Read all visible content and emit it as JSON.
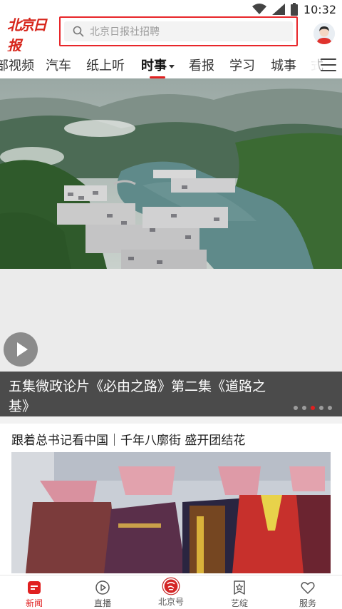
{
  "status_bar": {
    "time": "10:32",
    "icons": [
      "wifi-icon",
      "signal-icon",
      "battery-icon"
    ]
  },
  "header": {
    "logo_text": "北京日报",
    "search_placeholder": "北京日报社招聘",
    "avatar_icon": "user-avatar-icon"
  },
  "tabs": [
    {
      "label": "部视频"
    },
    {
      "label": "汽车"
    },
    {
      "label": "纸上听"
    },
    {
      "label": "时事",
      "active": true
    },
    {
      "label": "看报"
    },
    {
      "label": "学习"
    },
    {
      "label": "城事"
    },
    {
      "label": "式"
    }
  ],
  "hero": {
    "caption": "五集微政论片《必由之路》第二集《道路之基》",
    "slide_count": 5,
    "active_slide": 3
  },
  "article": {
    "title": "跟着总书记看中国｜千年八廓街 盛开团结花"
  },
  "bottom_nav": [
    {
      "label": "新闻",
      "icon": "news-icon",
      "active": true
    },
    {
      "label": "直播",
      "icon": "live-play-icon"
    },
    {
      "label": "北京号",
      "icon": "beijing-hao-icon"
    },
    {
      "label": "艺绽",
      "icon": "art-star-icon"
    },
    {
      "label": "服务",
      "icon": "heart-service-icon"
    }
  ],
  "colors": {
    "accent": "#e02020",
    "search_highlight": "#e8262a"
  }
}
